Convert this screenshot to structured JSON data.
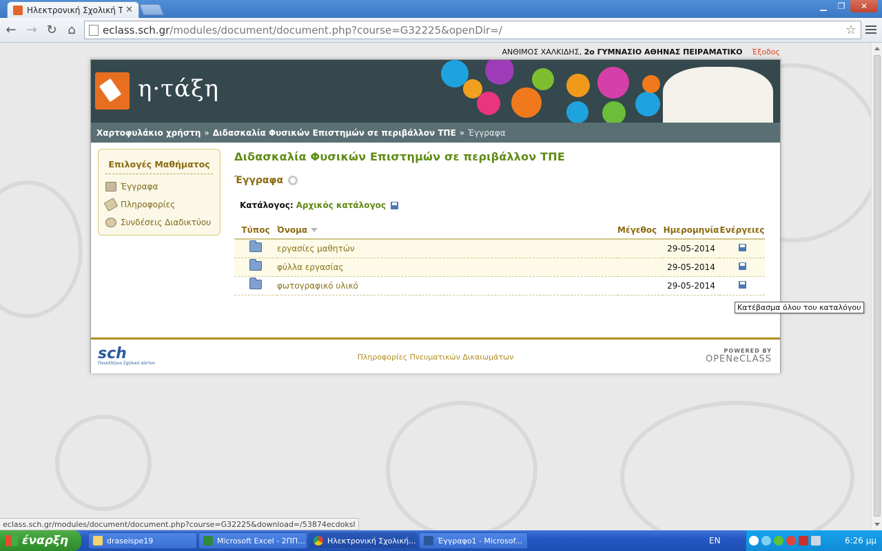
{
  "browser": {
    "tab_title": "Ηλεκτρονική Σχολική Τάξη (",
    "url_host": "eclass.sch.gr",
    "url_path": "/modules/document/document.php?course=G32225&openDir=/",
    "status_url": "eclass.sch.gr/modules/document/document.php?course=G32225&download=/53874ecdoksl"
  },
  "user_bar": {
    "name": "ΑΝΘΙΜΟΣ ΧΑΛΚΙΔΗΣ,",
    "school": "2ο ΓΥΜΝΑΣΙΟ ΑΘΗΝΑΣ ΠΕΙΡΑΜΑΤΙΚΟ",
    "logout": "Έξοδος"
  },
  "logo_text": "η·τάξη",
  "breadcrumb": {
    "portfolio": "Χαρτοφυλάκιο χρήστη",
    "course": "Διδασκαλία Φυσικών Επιστημών σε περιβάλλον ΤΠΕ",
    "current": "Έγγραφα",
    "separator": "»"
  },
  "sidebar": {
    "title": "Επιλογές Μαθήματος",
    "items": [
      {
        "label": "Έγγραφα"
      },
      {
        "label": "Πληροφορίες"
      },
      {
        "label": "Συνδέσεις Διαδικτύου"
      }
    ]
  },
  "content": {
    "course_title": "Διδασκαλία Φυσικών Επιστημών σε περιβάλλον ΤΠΕ",
    "section_title": "Έγγραφα",
    "catalog_label": "Κατάλογος:",
    "catalog_link": "Αρχικός κατάλογος"
  },
  "table": {
    "headers": {
      "type": "Τύπος",
      "name": "Όνομα",
      "size": "Μέγεθος",
      "date": "Ημερομηνία",
      "actions": "Ενέργειες"
    },
    "rows": [
      {
        "name": "εργασίες μαθητών",
        "size": "",
        "date": "29-05-2014"
      },
      {
        "name": "φύλλα εργασίας",
        "size": "",
        "date": "29-05-2014"
      },
      {
        "name": "φωτογραφικό υλικό",
        "size": "",
        "date": "29-05-2014"
      }
    ]
  },
  "tooltip": "Κατέβασμα όλου του καταλόγου",
  "footer": {
    "sch_brand": "sch",
    "sch_sub": "Πανελλήνιο Σχολικό Δίκτυο",
    "copyright_link": "Πληροφορίες Πνευματικών Δικαιωμάτων",
    "powered_by": "POWERED BY",
    "platform": "OPENeCLASS"
  },
  "taskbar": {
    "start": "έναρξη",
    "tasks": [
      {
        "label": "draseispe19"
      },
      {
        "label": "Microsoft Excel - 2ΠΠ..."
      },
      {
        "label": "Ηλεκτρονική Σχολική..."
      },
      {
        "label": "Έγγραφο1 - Microsof..."
      }
    ],
    "lang": "EN",
    "clock": "6:26 μμ"
  },
  "colors": {
    "accent_green": "#5f8b15",
    "accent_gold": "#8b6a10",
    "banner": "#34484d",
    "crumb_bar": "#5a6f73",
    "logout": "#d4441c"
  }
}
